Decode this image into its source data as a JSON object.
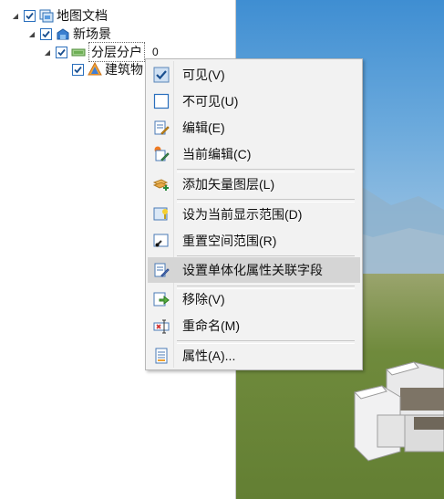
{
  "tree": {
    "items": [
      {
        "label": "地图文档",
        "level": 0,
        "checked": true,
        "expanded": true,
        "icon": "map-document-icon"
      },
      {
        "label": "新场景",
        "level": 1,
        "checked": true,
        "expanded": true,
        "icon": "scene-icon"
      },
      {
        "label": "分层分户",
        "level": 2,
        "checked": true,
        "expanded": true,
        "icon": "layer-group-icon",
        "badge": "0",
        "selected": true
      },
      {
        "label": "建筑物",
        "level": 3,
        "checked": true,
        "expanded": false,
        "icon": "building-icon"
      }
    ]
  },
  "context_menu": {
    "items": [
      {
        "label": "可见(V)",
        "icon": "visible-checked-icon"
      },
      {
        "label": "不可见(U)",
        "icon": "invisible-checkbox-icon"
      },
      {
        "label": "编辑(E)",
        "icon": "edit-icon"
      },
      {
        "label": "当前编辑(C)",
        "icon": "current-edit-icon"
      },
      {
        "label": "添加矢量图层(L)",
        "icon": "add-vector-layer-icon"
      },
      {
        "label": "设为当前显示范围(D)",
        "icon": "set-display-extent-icon"
      },
      {
        "label": "重置空间范围(R)",
        "icon": "reset-spatial-extent-icon"
      },
      {
        "label": "设置单体化属性关联字段",
        "icon": "set-attribute-field-icon",
        "highlighted": true
      },
      {
        "label": "移除(V)",
        "icon": "remove-icon"
      },
      {
        "label": "重命名(M)",
        "icon": "rename-icon"
      },
      {
        "label": "属性(A)...",
        "icon": "properties-icon"
      }
    ]
  },
  "colors": {
    "checkbox_border": "#2a6fbd",
    "menu_background": "#f2f2f2",
    "menu_highlight": "#d5d5d5",
    "sky_top": "#3f8ed2",
    "ground": "#6f8a3c"
  }
}
